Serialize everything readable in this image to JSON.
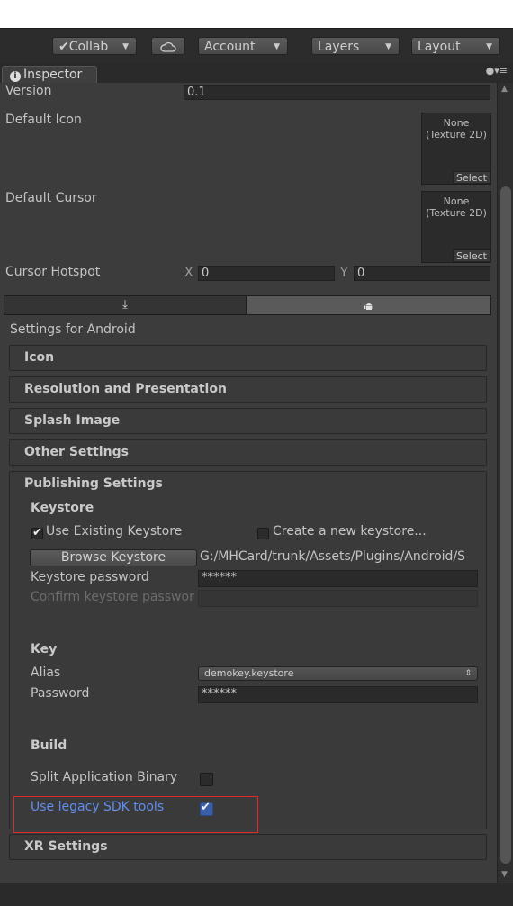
{
  "toolbar": {
    "collab": "Collab",
    "account": "Account",
    "layers": "Layers",
    "layout": "Layout"
  },
  "tab": {
    "label": "Inspector"
  },
  "fields": {
    "version_label": "Version",
    "version_value": "0.1",
    "default_icon_label": "Default Icon",
    "default_cursor_label": "Default Cursor",
    "texture_none": "None",
    "texture_type": "(Texture 2D)",
    "select_label": "Select",
    "cursor_hotspot_label": "Cursor Hotspot",
    "x_label": "X",
    "x_value": "0",
    "y_label": "Y",
    "y_value": "0"
  },
  "settings_for": "Settings for Android",
  "sections": {
    "icon": "Icon",
    "resolution": "Resolution and Presentation",
    "splash": "Splash Image",
    "other": "Other Settings",
    "publishing": "Publishing Settings",
    "xr": "XR Settings"
  },
  "publishing": {
    "keystore_heading": "Keystore",
    "use_existing": "Use Existing Keystore",
    "use_existing_checked": true,
    "create_new": "Create a new keystore...",
    "create_new_checked": false,
    "browse_button": "Browse Keystore",
    "keystore_path": "G:/MHCard/trunk/Assets/Plugins/Android/S",
    "keystore_password_label": "Keystore password",
    "keystore_password_value": "******",
    "confirm_password_label": "Confirm keystore passwor",
    "key_heading": "Key",
    "alias_label": "Alias",
    "alias_value": "demokey.keystore",
    "password_label": "Password",
    "password_value": "******",
    "build_heading": "Build",
    "split_binary_label": "Split Application Binary",
    "split_binary_checked": false,
    "legacy_sdk_label": "Use legacy SDK tools",
    "legacy_sdk_checked": true,
    "legacy_label_color": "#5f8ef0",
    "highlight_color": "#e02a2a"
  }
}
